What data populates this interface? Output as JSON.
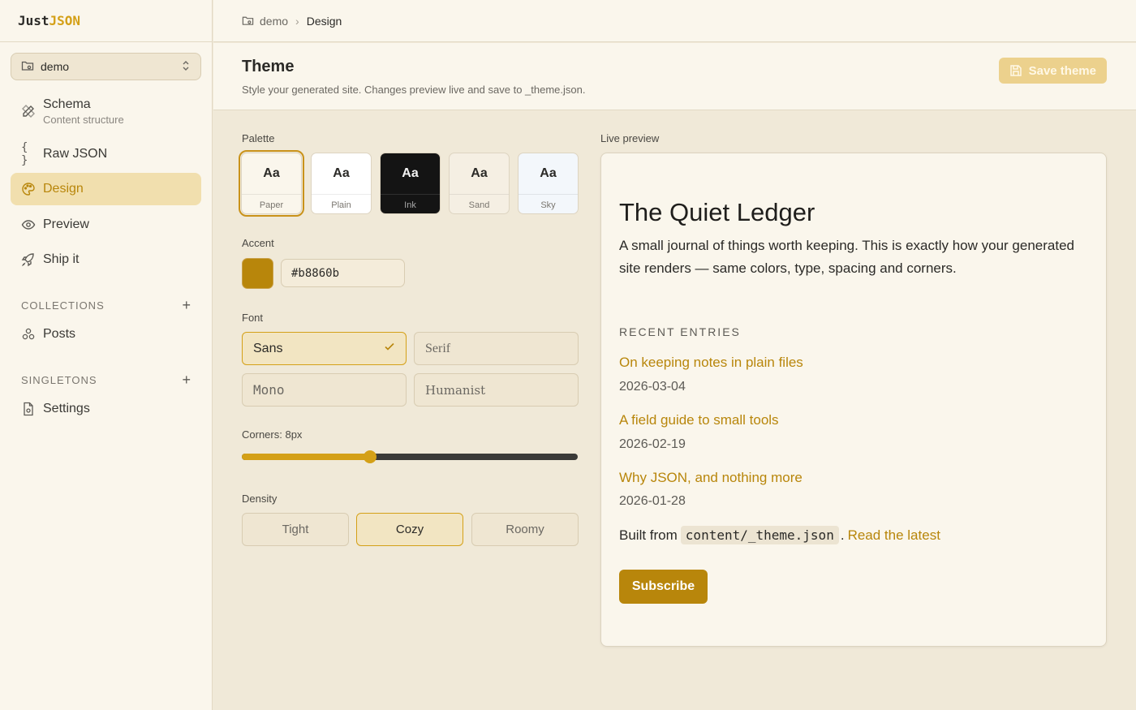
{
  "app": {
    "logo_a": "Just",
    "logo_b": "JSON"
  },
  "project_select": {
    "value": "demo"
  },
  "nav": {
    "schema": {
      "label": "Schema",
      "sub": "Content structure"
    },
    "raw_json": {
      "label": "Raw JSON"
    },
    "design": {
      "label": "Design"
    },
    "preview": {
      "label": "Preview"
    },
    "ship": {
      "label": "Ship it"
    }
  },
  "collections": {
    "heading": "COLLECTIONS",
    "add": "+",
    "items": [
      {
        "label": "Posts"
      }
    ]
  },
  "singletons": {
    "heading": "SINGLETONS",
    "add": "+",
    "items": [
      {
        "label": "Settings"
      }
    ]
  },
  "breadcrumb": {
    "root": "demo",
    "sep": "›",
    "current": "Design"
  },
  "header": {
    "title": "Theme",
    "subtitle": "Style your generated site. Changes preview live and save to _theme.json.",
    "save_label": "Save theme"
  },
  "palette": {
    "label": "Palette",
    "options": [
      {
        "sample": "Aa",
        "name": "Paper",
        "bg": "#faf6ec",
        "fg": "#2b2a27"
      },
      {
        "sample": "Aa",
        "name": "Plain",
        "bg": "#ffffff",
        "fg": "#2b2a27"
      },
      {
        "sample": "Aa",
        "name": "Ink",
        "bg": "#141414",
        "fg": "#f2f2f2"
      },
      {
        "sample": "Aa",
        "name": "Sand",
        "bg": "#f5efe3",
        "fg": "#2b2a27"
      },
      {
        "sample": "Aa",
        "name": "Sky",
        "bg": "#f3f7fb",
        "fg": "#2b2a27"
      }
    ],
    "selected": "Paper"
  },
  "accent": {
    "label": "Accent",
    "value": "#b8860b",
    "color": "#b8860b"
  },
  "font": {
    "label": "Font",
    "options": [
      "Sans",
      "Serif",
      "Mono",
      "Humanist"
    ],
    "selected": "Sans"
  },
  "corners": {
    "label": "Corners: 8px",
    "value": 8,
    "min": 0,
    "max": 24
  },
  "density": {
    "label": "Density",
    "options": [
      "Tight",
      "Cozy",
      "Roomy"
    ],
    "selected": "Cozy"
  },
  "preview": {
    "label": "Live preview",
    "title": "The Quiet Ledger",
    "description": "A small journal of things worth keeping. This is exactly how your generated site renders — same colors, type, spacing and corners.",
    "section": "RECENT ENTRIES",
    "entries": [
      {
        "title": "On keeping notes in plain files",
        "date": "2026-03-04"
      },
      {
        "title": "A field guide to small tools",
        "date": "2026-02-19"
      },
      {
        "title": "Why JSON, and nothing more",
        "date": "2026-01-28"
      }
    ],
    "built_prefix": "Built from",
    "built_code": "content/_theme.json",
    "built_suffix": ".",
    "built_link": "Read the latest",
    "button": "Subscribe"
  },
  "colors": {
    "accent": "#b8860b",
    "accent_light": "#d4a017",
    "sidebar_bg": "#faf6ec",
    "main_bg": "#f0e9d8"
  },
  "icons": {
    "project": "folder-icon",
    "select": "chevron-updown-icon",
    "schema": "pencil-ruler-icon",
    "raw_json": "braces-icon",
    "design": "palette-icon",
    "preview": "eye-icon",
    "ship": "rocket-icon",
    "posts": "shapes-icon",
    "settings": "file-gear-icon",
    "save": "save-icon",
    "check": "check-icon"
  }
}
